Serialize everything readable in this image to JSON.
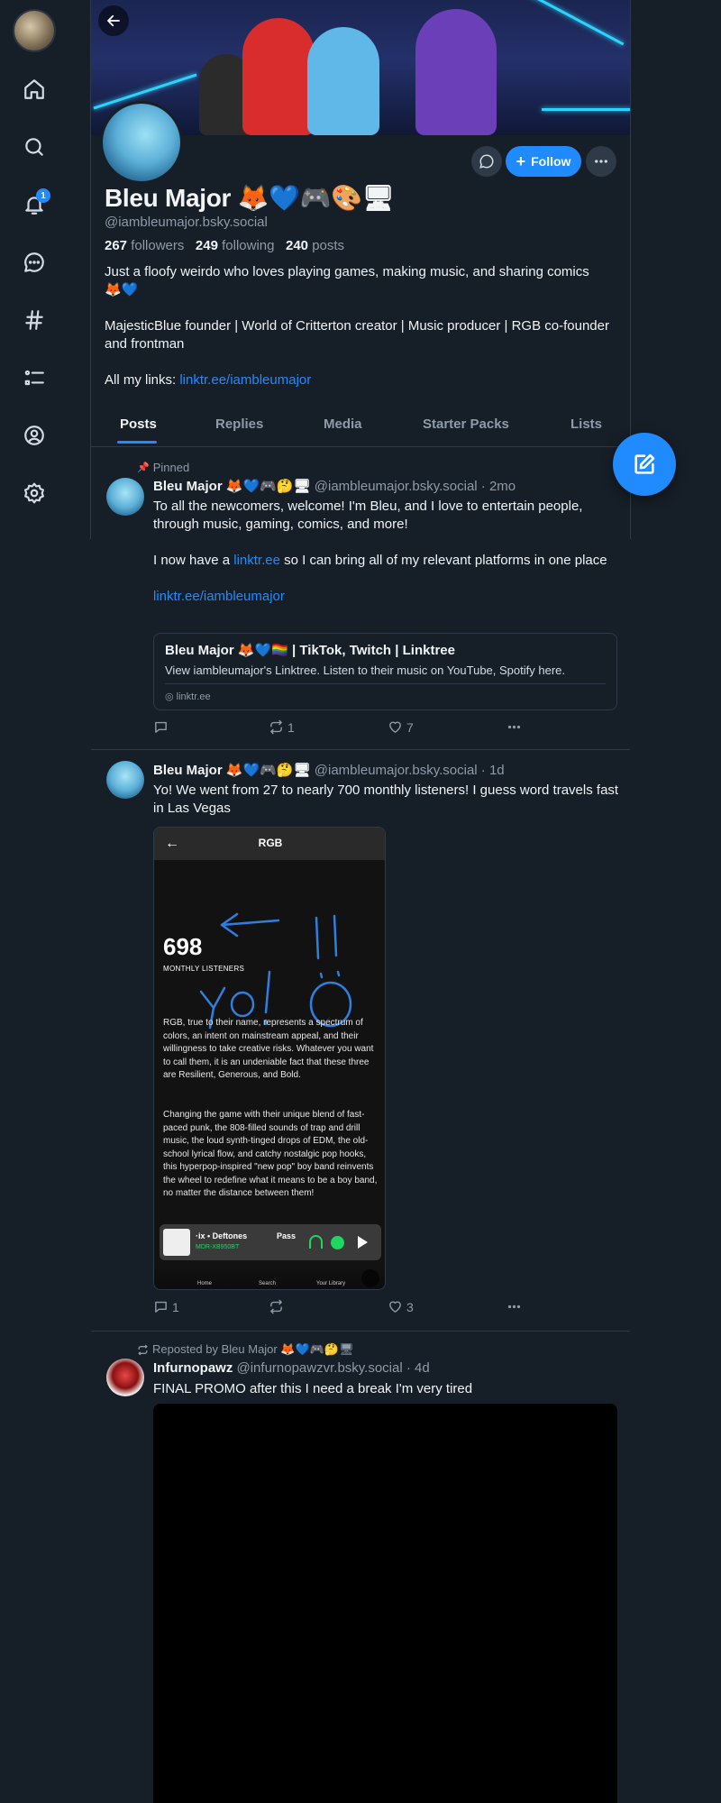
{
  "nav": {
    "items": [
      {
        "icon": "home-icon"
      },
      {
        "icon": "search-icon"
      },
      {
        "icon": "bell-icon",
        "badge": "1"
      },
      {
        "icon": "chat-icon"
      },
      {
        "icon": "hashtag-icon"
      },
      {
        "icon": "list-icon"
      },
      {
        "icon": "profile-icon"
      },
      {
        "icon": "gear-icon"
      }
    ]
  },
  "profile": {
    "display_name": "Bleu Major 🦊💙🎮🎨🖥",
    "handle": "@iambleumajor.bsky.social",
    "followers_count": "267",
    "followers_label": "followers",
    "following_count": "249",
    "following_label": "following",
    "posts_count": "240",
    "posts_label": "posts",
    "bio_line1": "Just a floofy weirdo who loves playing games, making music, and sharing comics 🦊💙",
    "bio_line2": "MajesticBlue founder | World of Critterton creator | Music producer | RGB co-founder and frontman",
    "bio_links_label": "All my links: ",
    "bio_link": "linktr.ee/iambleumajor",
    "follow_label": "Follow"
  },
  "tabs": [
    "Posts",
    "Replies",
    "Media",
    "Starter Packs",
    "Lists"
  ],
  "posts": [
    {
      "pinned_label": "Pinned",
      "author_name": "Bleu Major 🦊💙🎮🤔🖥",
      "author_handle": "@iambleumajor.bsky.social · 2mo",
      "text1": "To all the newcomers, welcome! I'm Bleu, and I love to entertain people, through music, gaming, comics, and more!",
      "text2_pre": "I now have a ",
      "text2_link": "linktr.ee",
      "text2_post": " so I can bring all of my relevant platforms in one place",
      "text3_link": "linktr.ee/iambleumajor",
      "card_title": "Bleu Major 🦊💙🏳️‍🌈 | TikTok, Twitch | Linktree",
      "card_desc": "View iambleumajor's Linktree. Listen to their music on YouTube, Spotify here.",
      "card_domain": "linktr.ee",
      "reply_count": "",
      "repost_count": "1",
      "like_count": "7"
    },
    {
      "author_name": "Bleu Major 🦊💙🎮🤔🖥",
      "author_handle": "@iambleumajor.bsky.social · 1d",
      "text1": "Yo! We went from 27 to nearly 700 monthly listeners! I guess word travels fast in Las Vegas",
      "image": {
        "title": "RGB",
        "listeners": "698",
        "listeners_label": "MONTHLY LISTENERS",
        "para1": "RGB, true to their name, represents a spectrum of colors, an intent on mainstream appeal, and their willingness to take creative risks. Whatever you want to call them, it is an undeniable fact that these three are Resilient, Generous, and Bold.",
        "para2": "Changing the game with their unique blend of fast-paced punk, the 808-filled sounds of trap and drill music, the loud synth-tinged drops of EDM, the old-school lyrical flow, and catchy nostalgic pop hooks, this hyperpop-inspired \"new pop\" boy band reinvents the wheel to redefine what it means to be a boy band, no matter the distance between them!",
        "player_track": "·ix • Deftones",
        "player_device": "MDR-XB950BT",
        "player_next": "Pass",
        "nav_home": "Home",
        "nav_search": "Search",
        "nav_library": "Your Library"
      },
      "reply_count": "1",
      "repost_count": "",
      "like_count": "3"
    },
    {
      "repost_label": "Reposted by Bleu Major 🦊💙🎮🤔🖥",
      "author_name": "Infurnopawz",
      "author_handle": "@infurnopawzvr.bsky.social · 4d",
      "text1": "FINAL PROMO after this I need a break I'm very tired"
    }
  ],
  "colors": {
    "background": "#161e27",
    "accent": "#208bfe",
    "muted": "#8f9ba8",
    "border": "#2e3a47"
  }
}
